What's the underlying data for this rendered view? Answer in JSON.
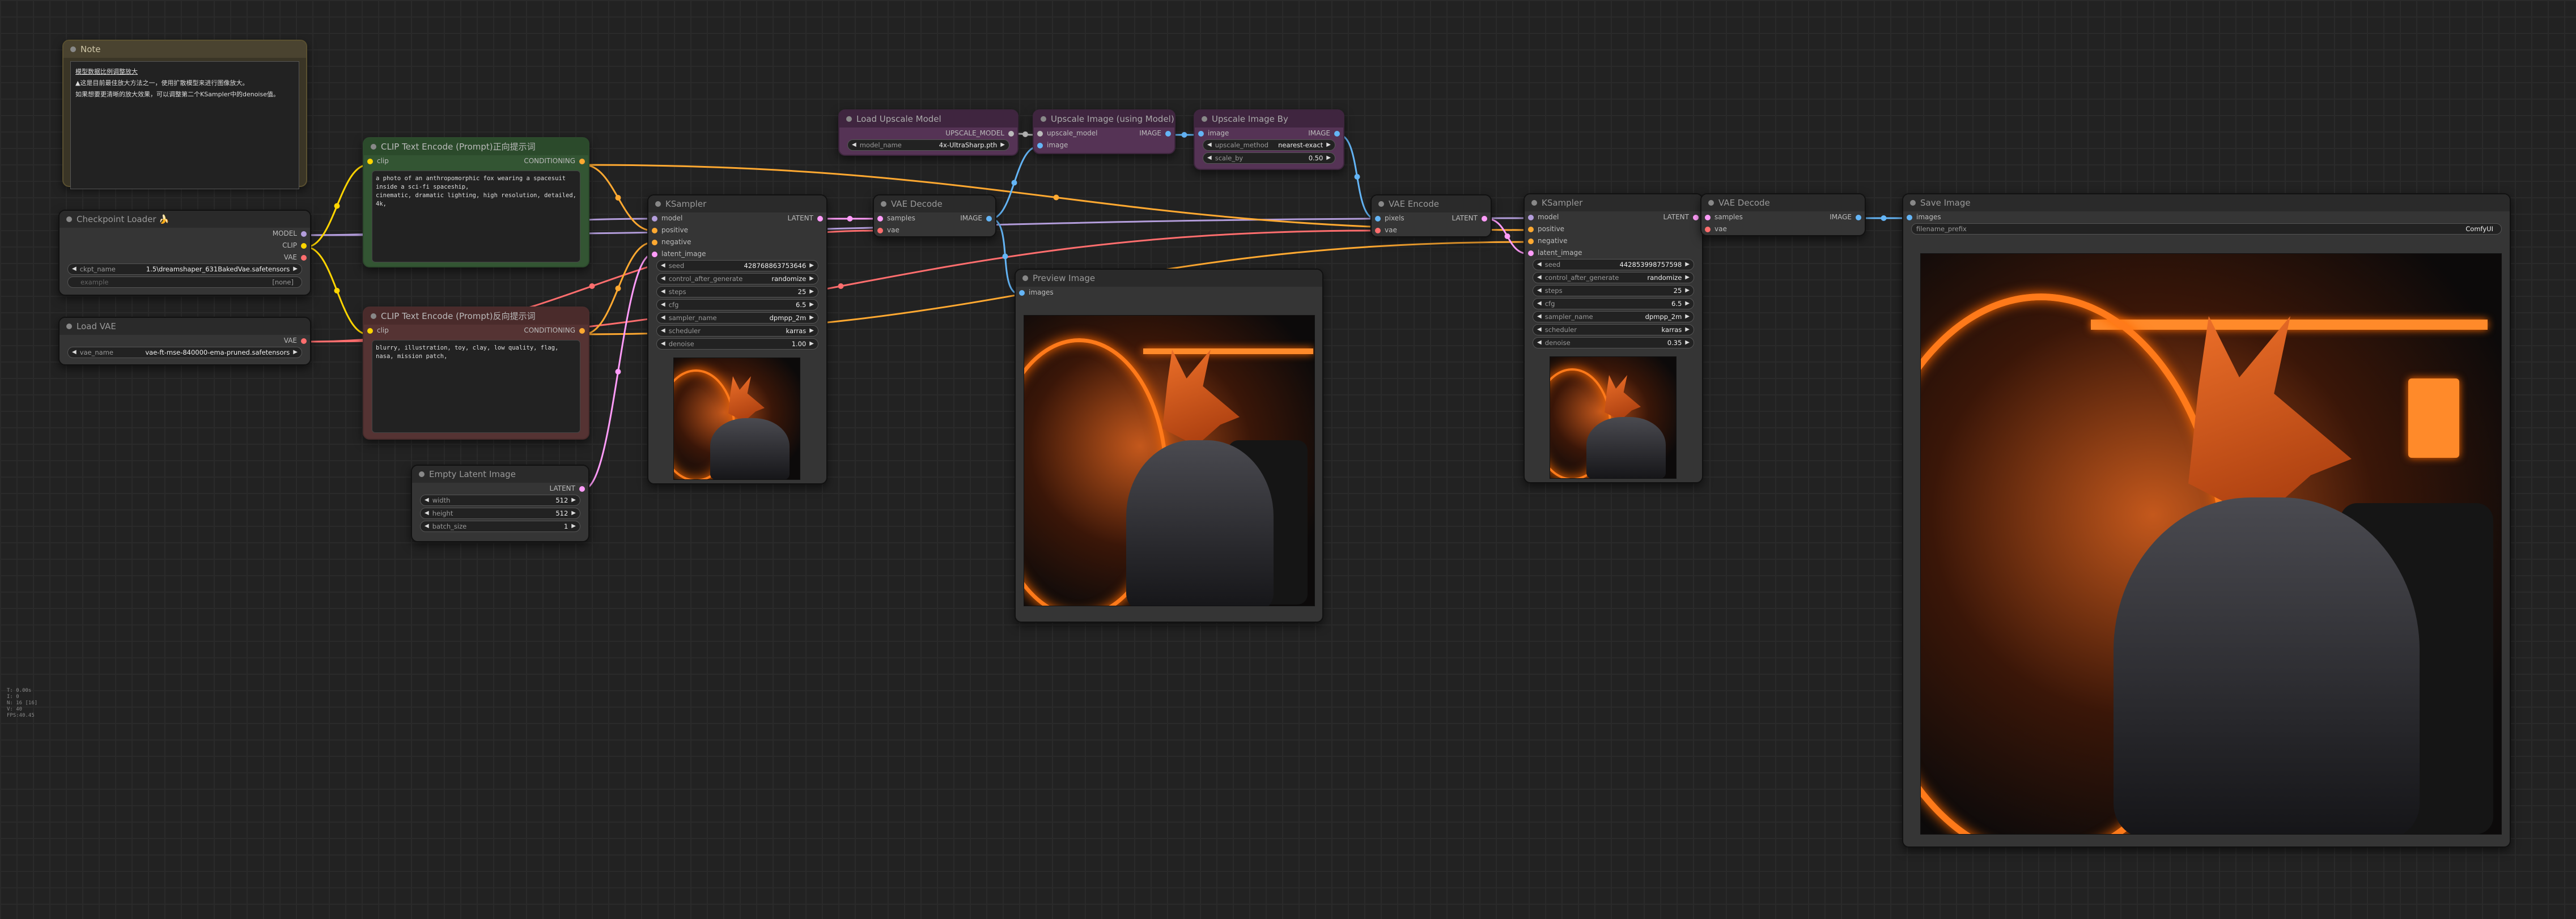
{
  "note": {
    "title": "Note",
    "lines": [
      "模型数据比例调整放大",
      "▲这是目前最佳放大方法之一，使用扩散模型来进行图像放大。",
      "如果想要更清晰的放大效果，可以调整第二个KSampler中的denoise值。"
    ]
  },
  "checkpoint": {
    "title": "Checkpoint Loader 🍌",
    "out_model": "MODEL",
    "out_clip": "CLIP",
    "out_vae": "VAE",
    "ckpt_label": "ckpt_name",
    "ckpt_value": "1.5\\dreamshaper_631BakedVae.safetensors",
    "example_label": "example",
    "example_value": "[none]"
  },
  "load_vae": {
    "title": "Load VAE",
    "out_vae": "VAE",
    "label": "vae_name",
    "value": "vae-ft-mse-840000-ema-pruned.safetensors"
  },
  "clip_pos": {
    "title": "CLIP Text Encode (Prompt)正向提示词",
    "in_clip": "clip",
    "out": "CONDITIONING",
    "text": "a photo of an anthropomorphic fox wearing a spacesuit inside a sci-fi spaceship,\ncinematic, dramatic lighting, high resolution, detailed, 4k,"
  },
  "clip_neg": {
    "title": "CLIP Text Encode (Prompt)反向提示词",
    "in_clip": "clip",
    "out": "CONDITIONING",
    "text": "blurry, illustration, toy, clay, low quality, flag, nasa, mission patch,"
  },
  "empty_latent": {
    "title": "Empty Latent Image",
    "out": "LATENT",
    "widgets": [
      {
        "label": "width",
        "value": "512"
      },
      {
        "label": "height",
        "value": "512"
      },
      {
        "label": "batch_size",
        "value": "1"
      }
    ]
  },
  "ksampler1": {
    "title": "KSampler",
    "inputs": [
      "model",
      "positive",
      "negative",
      "latent_image"
    ],
    "out": "LATENT",
    "widgets": [
      {
        "label": "seed",
        "value": "428768863753646"
      },
      {
        "label": "control_after_generate",
        "value": "randomize"
      },
      {
        "label": "steps",
        "value": "25"
      },
      {
        "label": "cfg",
        "value": "6.5"
      },
      {
        "label": "sampler_name",
        "value": "dpmpp_2m"
      },
      {
        "label": "scheduler",
        "value": "karras"
      },
      {
        "label": "denoise",
        "value": "1.00"
      }
    ]
  },
  "vae_decode1": {
    "title": "VAE Decode",
    "inputs": [
      "samples",
      "vae"
    ],
    "out": "IMAGE"
  },
  "preview": {
    "title": "Preview Image",
    "input": "images"
  },
  "load_upscale": {
    "title": "Load Upscale Model",
    "out": "UPSCALE_MODEL",
    "label": "model_name",
    "value": "4x-UltraSharp.pth"
  },
  "upscale_model": {
    "title": "Upscale Image (using Model)",
    "inputs": [
      "upscale_model",
      "image"
    ],
    "out": "IMAGE"
  },
  "upscale_by": {
    "title": "Upscale Image By",
    "input": "image",
    "out": "IMAGE",
    "widgets": [
      {
        "label": "upscale_method",
        "value": "nearest-exact"
      },
      {
        "label": "scale_by",
        "value": "0.50"
      }
    ]
  },
  "vae_encode": {
    "title": "VAE Encode",
    "inputs": [
      "pixels",
      "vae"
    ],
    "out": "LATENT"
  },
  "ksampler2": {
    "title": "KSampler",
    "inputs": [
      "model",
      "positive",
      "negative",
      "latent_image"
    ],
    "out": "LATENT",
    "widgets": [
      {
        "label": "seed",
        "value": "442853998757598"
      },
      {
        "label": "control_after_generate",
        "value": "randomize"
      },
      {
        "label": "steps",
        "value": "25"
      },
      {
        "label": "cfg",
        "value": "6.5"
      },
      {
        "label": "sampler_name",
        "value": "dpmpp_2m"
      },
      {
        "label": "scheduler",
        "value": "karras"
      },
      {
        "label": "denoise",
        "value": "0.35"
      }
    ]
  },
  "vae_decode2": {
    "title": "VAE Decode",
    "inputs": [
      "samples",
      "vae"
    ],
    "out": "IMAGE"
  },
  "save": {
    "title": "Save Image",
    "input": "images",
    "label": "filename_prefix",
    "value": "ComfyUI"
  },
  "info": [
    "T: 0.00s",
    "I: 0",
    "N: 16 [16]",
    "V: 40",
    "FPS:40.45"
  ],
  "colors": {
    "model": "#b39ddb",
    "clip": "#ffd500",
    "vae": "#ff6e6e",
    "conditioning": "#ffa931",
    "latent": "#ff9cf9",
    "image": "#64b5f6",
    "upscale_model": "#bbbbbb"
  }
}
